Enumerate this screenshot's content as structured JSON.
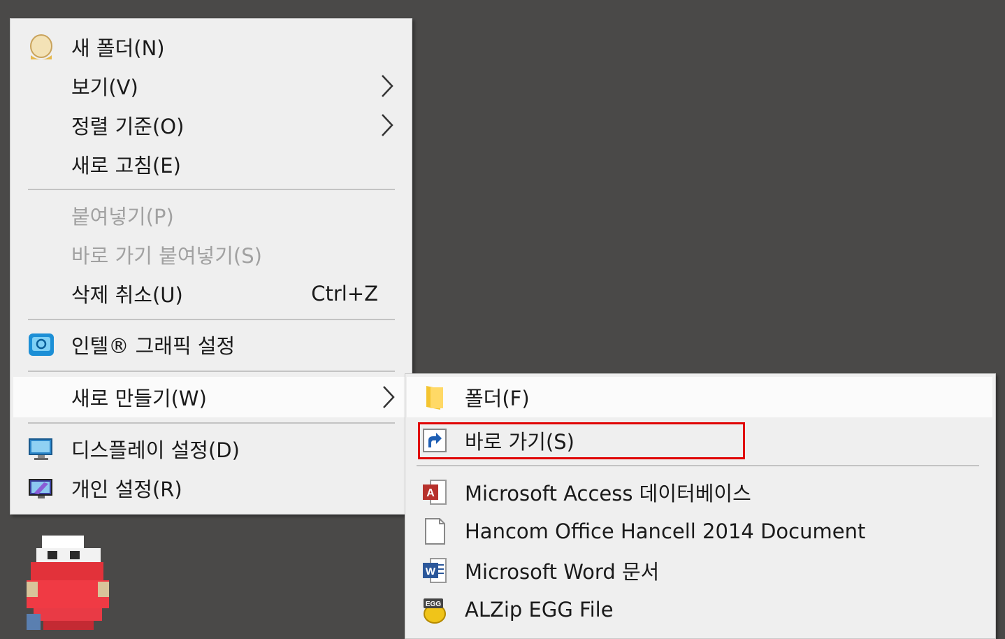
{
  "context_menu": {
    "items": [
      {
        "label": "새 폴더(N)",
        "icon": "user-folder-icon"
      },
      {
        "label": "보기(V)"
      },
      {
        "label": "정렬 기준(O)"
      },
      {
        "label": "새로 고침(E)"
      },
      {
        "label": "붙여넣기(P)",
        "disabled": true
      },
      {
        "label": "바로 가기 붙여넣기(S)",
        "disabled": true
      },
      {
        "label": "삭제 취소(U)",
        "shortcut": "Ctrl+Z"
      },
      {
        "label": "인텔® 그래픽 설정",
        "icon": "intel-graphics-icon"
      },
      {
        "label": "새로 만들기(W)",
        "highlighted": true
      },
      {
        "label": "디스플레이 설정(D)",
        "icon": "display-icon"
      },
      {
        "label": "개인 설정(R)",
        "icon": "personalize-icon"
      }
    ]
  },
  "new_submenu": {
    "items": [
      {
        "label": "폴더(F)",
        "icon": "folder-icon"
      },
      {
        "label": "바로 가기(S)",
        "icon": "shortcut-icon",
        "outlined": true
      },
      {
        "label": "Microsoft Access 데이터베이스",
        "icon": "access-icon"
      },
      {
        "label": "Hancom Office Hancell 2014 Document",
        "icon": "blank-document-icon"
      },
      {
        "label": "Microsoft Word 문서",
        "icon": "word-icon"
      },
      {
        "label": "ALZip EGG File",
        "icon": "egg-file-icon"
      }
    ]
  },
  "icon_text": {
    "access": "A",
    "word": "W",
    "egg": "EGG"
  },
  "colors": {
    "desktop": "#4a4948",
    "menu_bg": "#efefef",
    "highlight_bg": "#fbfbfb",
    "disabled_text": "#a1a1a1",
    "outline": "#e00000"
  }
}
